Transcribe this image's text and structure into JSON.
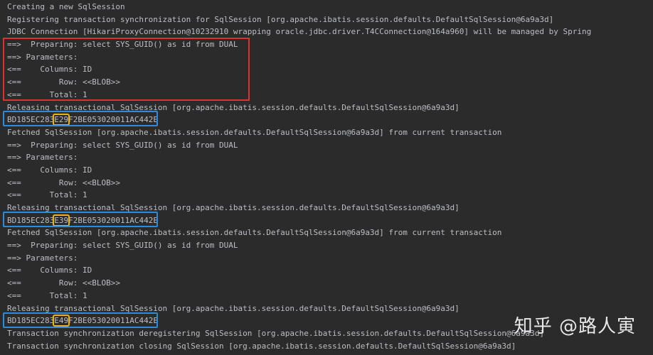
{
  "console": {
    "lines": [
      "Creating a new SqlSession",
      "Registering transaction synchronization for SqlSession [org.apache.ibatis.session.defaults.DefaultSqlSession@6a9a3d]",
      "JDBC Connection [HikariProxyConnection@10232910 wrapping oracle.jdbc.driver.T4CConnection@164a960] will be managed by Spring",
      "==>  Preparing: select SYS_GUID() as id from DUAL",
      "==> Parameters: ",
      "<==    Columns: ID",
      "<==        Row: <<BLOB>>",
      "<==      Total: 1",
      "Releasing transactional SqlSession [org.apache.ibatis.session.defaults.DefaultSqlSession@6a9a3d]",
      "",
      "Fetched SqlSession [org.apache.ibatis.session.defaults.DefaultSqlSession@6a9a3d] from current transaction",
      "==>  Preparing: select SYS_GUID() as id from DUAL",
      "==> Parameters: ",
      "<==    Columns: ID",
      "<==        Row: <<BLOB>>",
      "<==      Total: 1",
      "Releasing transactional SqlSession [org.apache.ibatis.session.defaults.DefaultSqlSession@6a9a3d]",
      "",
      "Fetched SqlSession [org.apache.ibatis.session.defaults.DefaultSqlSession@6a9a3d] from current transaction",
      "==>  Preparing: select SYS_GUID() as id from DUAL",
      "==> Parameters: ",
      "<==    Columns: ID",
      "<==        Row: <<BLOB>>",
      "<==      Total: 1",
      "Releasing transactional SqlSession [org.apache.ibatis.session.defaults.DefaultSqlSession@6a9a3d]",
      "",
      "Transaction synchronization deregistering SqlSession [org.apache.ibatis.session.defaults.DefaultSqlSession@6a9a3d]",
      "Transaction synchronization closing SqlSession [org.apache.ibatis.session.defaults.DefaultSqlSession@6a9a3d]"
    ],
    "guids": [
      {
        "prefix": "BD185EC283",
        "highlight": "E29",
        "suffix": "F2BE053020011AC442E"
      },
      {
        "prefix": "BD185EC283",
        "highlight": "E39",
        "suffix": "F2BE053020011AC442E"
      },
      {
        "prefix": "BD185EC283",
        "highlight": "E49",
        "suffix": "F2BE053020011AC442E"
      }
    ],
    "highlight_color": "#e8b417",
    "red_box_color": "#e03030",
    "blue_box_color": "#2a8ce0"
  },
  "watermark": {
    "text": "知乎 @路人寅"
  }
}
